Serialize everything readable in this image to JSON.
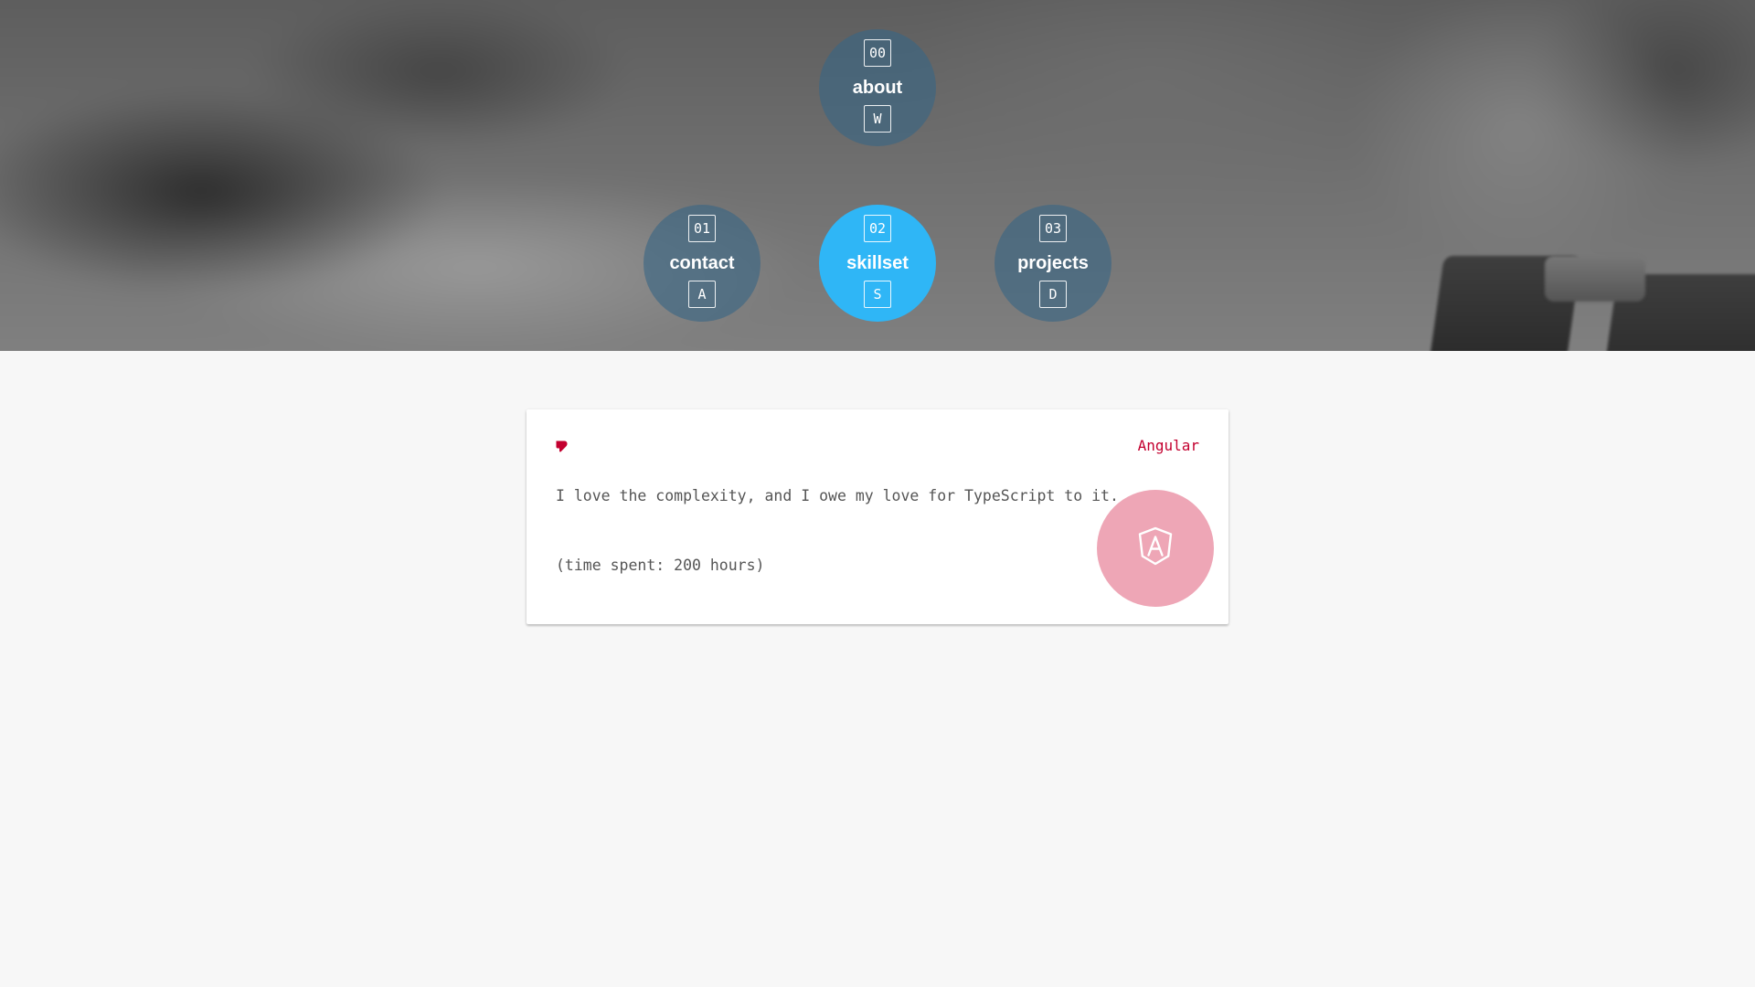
{
  "nav": {
    "items": [
      {
        "number": "00",
        "label": "about",
        "key": "W",
        "active": false
      },
      {
        "number": "01",
        "label": "contact",
        "key": "A",
        "active": false
      },
      {
        "number": "02",
        "label": "skillset",
        "key": "S",
        "active": true
      },
      {
        "number": "03",
        "label": "projects",
        "key": "D",
        "active": false
      }
    ]
  },
  "skill_card": {
    "name": "Angular",
    "description": "I love the complexity, and I owe my love for TypeScript to it.",
    "time_spent": "(time spent: 200 hours)",
    "icons": {
      "favorite": "heart-icon",
      "logo": "angular-logo-icon"
    }
  },
  "colors": {
    "nav_inactive": "#396685",
    "nav_active": "#2fb6f6",
    "accent": "#c3002f",
    "logo_circle": "#eea6b6",
    "page_background": "#f7f7f7"
  }
}
